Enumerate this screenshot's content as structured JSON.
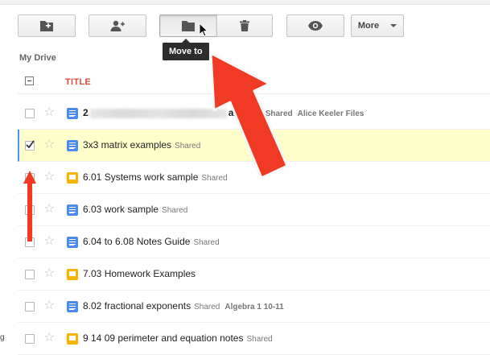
{
  "toolbar": {
    "buttons": [
      {
        "name": "new-folder",
        "icon": "folder-plus-icon"
      },
      {
        "name": "share",
        "icon": "add-person-icon"
      },
      {
        "name": "move-to",
        "icon": "folder-icon"
      },
      {
        "name": "delete",
        "icon": "trash-icon"
      },
      {
        "name": "preview",
        "icon": "eye-icon"
      }
    ],
    "more_label": "More"
  },
  "tooltip": "Move to",
  "breadcrumb": "My Drive",
  "list": {
    "title_header": "TITLE",
    "rows": [
      {
        "prefix": "2",
        "name": "archive",
        "type": "doc",
        "shared": "Shared",
        "folder": "Alice Keeler Files",
        "selected": false,
        "redacted": true
      },
      {
        "name": "3x3 matrix examples",
        "type": "doc",
        "shared": "Shared",
        "folder": "",
        "selected": true
      },
      {
        "name": "6.01 Systems work sample",
        "type": "pres",
        "shared": "Shared",
        "folder": "",
        "selected": false
      },
      {
        "name": "6.03 work sample",
        "type": "doc",
        "shared": "Shared",
        "folder": "",
        "selected": false
      },
      {
        "name": "6.04 to 6.08 Notes Guide",
        "type": "doc",
        "shared": "Shared",
        "folder": "",
        "selected": false
      },
      {
        "name": "7.03 Homework Examples",
        "type": "pres",
        "shared": "",
        "folder": "",
        "selected": false
      },
      {
        "name": "8.02 fractional exponents",
        "type": "doc",
        "shared": "Shared",
        "folder": "Algebra 1 10-11",
        "selected": false
      },
      {
        "name": "9 14 09 perimeter and equation notes",
        "type": "pres",
        "shared": "Shared",
        "folder": "",
        "selected": false
      }
    ]
  },
  "edge_text": "g",
  "colors": {
    "accent_blue": "#4d90fe",
    "title_red": "#dd4b39",
    "selected_row": "#ffffcc",
    "annotation_arrow": "#f03a24"
  }
}
